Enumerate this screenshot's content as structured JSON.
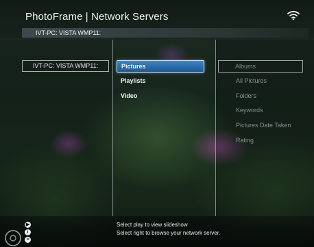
{
  "header": {
    "title": "PhotoFrame | Network Servers",
    "subtitle": "IVT-PC: VISTA WMP11:"
  },
  "left_column": {
    "server": "IVT-PC: VISTA WMP11:"
  },
  "middle_column": {
    "items": [
      {
        "label": "Pictures",
        "selected": true
      },
      {
        "label": "Playlists",
        "selected": false
      },
      {
        "label": "Video",
        "selected": false
      }
    ]
  },
  "right_column": {
    "items": [
      {
        "label": "Albums"
      },
      {
        "label": "All Pictures"
      },
      {
        "label": "Folders"
      },
      {
        "label": "Keywords"
      },
      {
        "label": "Pictures Date Taken"
      },
      {
        "label": "Rating"
      }
    ]
  },
  "footer": {
    "hint_1": "Select play to view slideshow",
    "hint_2": "Select right to browse your network server."
  },
  "icons": {
    "wifi": "wifi-icon",
    "nav": "navigation-ring-icon"
  },
  "colors": {
    "selection": "#2c6aa8"
  }
}
